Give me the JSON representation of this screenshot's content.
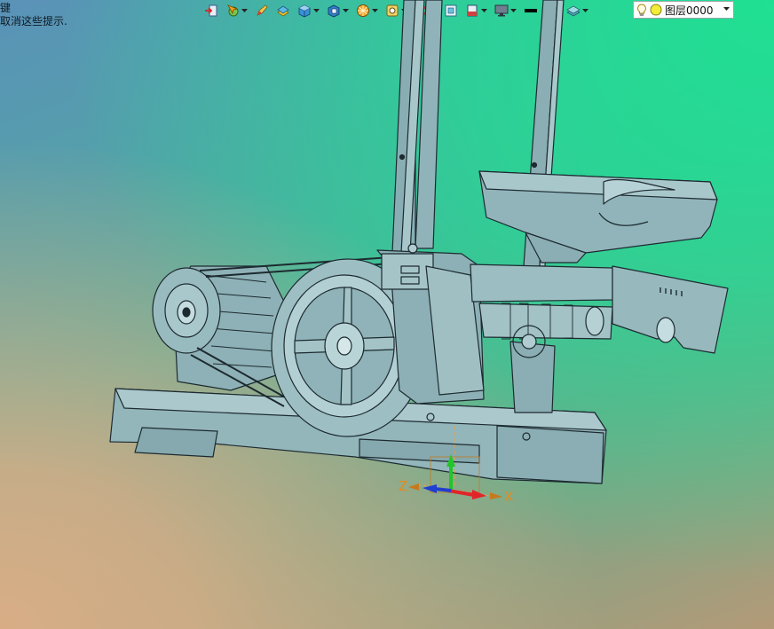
{
  "hint": {
    "line1": "键",
    "line2": "取消这些提示."
  },
  "toolbar": {
    "items": [
      {
        "icon": "import-icon",
        "dropdown": false
      },
      {
        "icon": "cursor-select-icon",
        "dropdown": true
      },
      {
        "icon": "pencil-icon",
        "dropdown": false
      },
      {
        "icon": "surface-icon",
        "dropdown": false
      },
      {
        "icon": "solid-box-icon",
        "dropdown": true
      },
      {
        "icon": "view-cube-icon",
        "dropdown": true
      },
      {
        "icon": "render-ball-icon",
        "dropdown": true
      },
      {
        "icon": "snap-icon",
        "dropdown": true
      },
      {
        "icon": "rotate-view-icon",
        "dropdown": true
      },
      {
        "icon": "fit-window-icon",
        "dropdown": false
      },
      {
        "icon": "section-icon",
        "dropdown": true
      },
      {
        "icon": "monitor-icon",
        "dropdown": true
      },
      {
        "icon": "line-width-icon",
        "dropdown": false
      },
      {
        "icon": "color-swatch-icon",
        "dropdown": false
      },
      {
        "icon": "layer-stack-icon",
        "dropdown": true
      }
    ],
    "layer": {
      "label": "图层0000",
      "bulb_icon": "lightbulb-icon",
      "state_icon": "layer-on-icon"
    }
  },
  "triad": {
    "x_label": "X",
    "z_label": "Z",
    "x_color": "#e0242a",
    "y_color": "#22c52b",
    "z_color": "#1f3fd0",
    "label_color": "#e58a1e"
  },
  "colors": {
    "model_fill": "#8fb3b8",
    "model_line": "#1d2a30"
  }
}
